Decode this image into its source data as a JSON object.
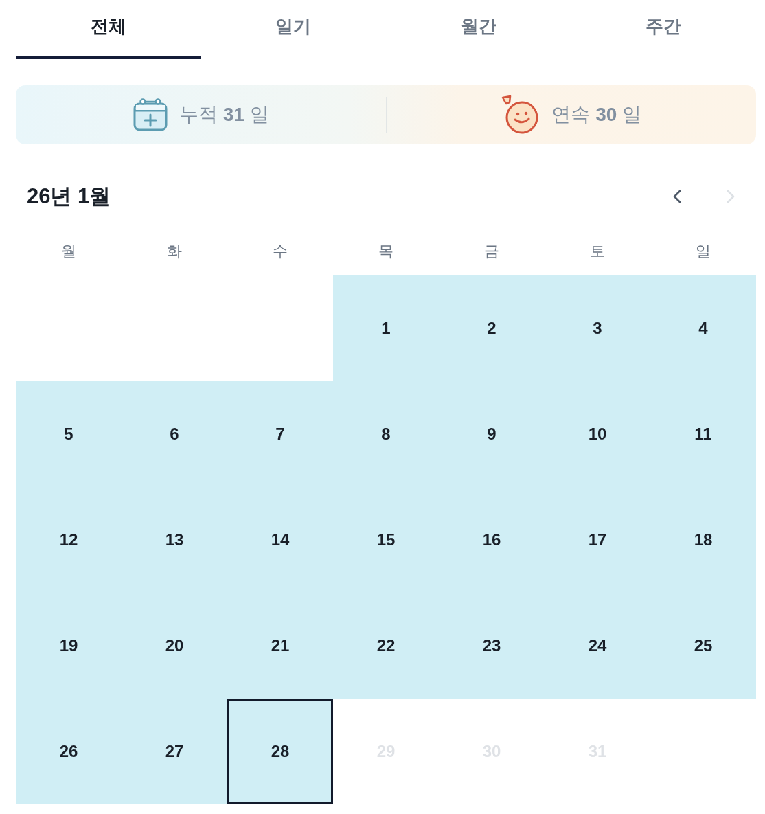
{
  "tabs": [
    {
      "label": "전체",
      "selected": true
    },
    {
      "label": "일기",
      "selected": false
    },
    {
      "label": "월간",
      "selected": false
    },
    {
      "label": "주간",
      "selected": false
    }
  ],
  "stats": [
    {
      "kind": "total",
      "text": "누적 **31** 일"
    },
    {
      "kind": "streak",
      "text": "연속 **30** 일"
    }
  ],
  "calendar": {
    "title": "26년 1월",
    "prev": {
      "disabled": false
    },
    "next": {
      "disabled": true
    },
    "weekdays": [
      "월",
      "화",
      "수",
      "목",
      "금",
      "토",
      "일"
    ],
    "weeks": [
      [
        {
          "kind": "empty"
        },
        {
          "kind": "empty"
        },
        {
          "kind": "empty"
        },
        {
          "kind": "day",
          "label": "1",
          "recorded": true,
          "selected": false,
          "disabled": false
        },
        {
          "kind": "day",
          "label": "2",
          "recorded": true,
          "selected": false,
          "disabled": false
        },
        {
          "kind": "day",
          "label": "3",
          "recorded": true,
          "selected": false,
          "disabled": false
        },
        {
          "kind": "day",
          "label": "4",
          "recorded": true,
          "selected": false,
          "disabled": false
        }
      ],
      [
        {
          "kind": "day",
          "label": "5",
          "recorded": true,
          "selected": false,
          "disabled": false
        },
        {
          "kind": "day",
          "label": "6",
          "recorded": true,
          "selected": false,
          "disabled": false
        },
        {
          "kind": "day",
          "label": "7",
          "recorded": true,
          "selected": false,
          "disabled": false
        },
        {
          "kind": "day",
          "label": "8",
          "recorded": true,
          "selected": false,
          "disabled": false
        },
        {
          "kind": "day",
          "label": "9",
          "recorded": true,
          "selected": false,
          "disabled": false
        },
        {
          "kind": "day",
          "label": "10",
          "recorded": true,
          "selected": false,
          "disabled": false
        },
        {
          "kind": "day",
          "label": "11",
          "recorded": true,
          "selected": false,
          "disabled": false
        }
      ],
      [
        {
          "kind": "day",
          "label": "12",
          "recorded": true,
          "selected": false,
          "disabled": false
        },
        {
          "kind": "day",
          "label": "13",
          "recorded": true,
          "selected": false,
          "disabled": false
        },
        {
          "kind": "day",
          "label": "14",
          "recorded": true,
          "selected": false,
          "disabled": false
        },
        {
          "kind": "day",
          "label": "15",
          "recorded": true,
          "selected": false,
          "disabled": false
        },
        {
          "kind": "day",
          "label": "16",
          "recorded": true,
          "selected": false,
          "disabled": false
        },
        {
          "kind": "day",
          "label": "17",
          "recorded": true,
          "selected": false,
          "disabled": false
        },
        {
          "kind": "day",
          "label": "18",
          "recorded": true,
          "selected": false,
          "disabled": false
        }
      ],
      [
        {
          "kind": "day",
          "label": "19",
          "recorded": true,
          "selected": false,
          "disabled": false
        },
        {
          "kind": "day",
          "label": "20",
          "recorded": true,
          "selected": false,
          "disabled": false
        },
        {
          "kind": "day",
          "label": "21",
          "recorded": true,
          "selected": false,
          "disabled": false
        },
        {
          "kind": "day",
          "label": "22",
          "recorded": true,
          "selected": false,
          "disabled": false
        },
        {
          "kind": "day",
          "label": "23",
          "recorded": true,
          "selected": false,
          "disabled": false
        },
        {
          "kind": "day",
          "label": "24",
          "recorded": true,
          "selected": false,
          "disabled": false
        },
        {
          "kind": "day",
          "label": "25",
          "recorded": true,
          "selected": false,
          "disabled": false
        }
      ],
      [
        {
          "kind": "day",
          "label": "26",
          "recorded": true,
          "selected": false,
          "disabled": false
        },
        {
          "kind": "day",
          "label": "27",
          "recorded": true,
          "selected": false,
          "disabled": false
        },
        {
          "kind": "day",
          "label": "28",
          "recorded": true,
          "selected": true,
          "disabled": false
        },
        {
          "kind": "day",
          "label": "29",
          "recorded": false,
          "selected": false,
          "disabled": true
        },
        {
          "kind": "day",
          "label": "30",
          "recorded": false,
          "selected": false,
          "disabled": true
        },
        {
          "kind": "day",
          "label": "31",
          "recorded": false,
          "selected": false,
          "disabled": true
        },
        {
          "kind": "empty"
        }
      ]
    ]
  }
}
